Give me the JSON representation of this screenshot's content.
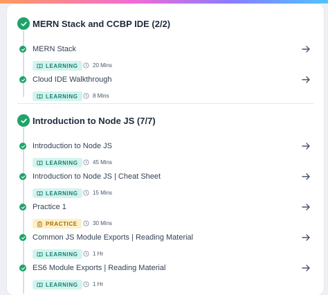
{
  "sections": [
    {
      "title": "MERN Stack and CCBP IDE (2/2)",
      "items": [
        {
          "title": "MERN Stack",
          "badge": "LEARNING",
          "duration": "20 Mins"
        },
        {
          "title": "Cloud IDE Walkthrough",
          "badge": "LEARNING",
          "duration": "8 Mins"
        }
      ]
    },
    {
      "title": "Introduction to Node JS (7/7)",
      "items": [
        {
          "title": "Introduction to Node JS",
          "badge": "LEARNING",
          "duration": "45 Mins"
        },
        {
          "title": "Introduction to Node JS | Cheat Sheet",
          "badge": "LEARNING",
          "duration": "15 Mins"
        },
        {
          "title": "Practice 1",
          "badge": "PRACTICE",
          "duration": "30 Mins"
        },
        {
          "title": "Common JS Module Exports | Reading Material",
          "badge": "LEARNING",
          "duration": "1 Hr"
        },
        {
          "title": "ES6 Module Exports | Reading Material",
          "badge": "LEARNING",
          "duration": "1 Hr"
        }
      ]
    }
  ],
  "icons": {
    "section_status": "check-circle-icon",
    "item_status": "check-dot-icon",
    "open": "arrow-right-icon",
    "learning": "book-icon",
    "practice": "clipboard-icon",
    "duration": "clock-icon"
  },
  "colors": {
    "complete": "#1fa36a",
    "learning_bg": "#d3f4ee",
    "learning_text": "#15806f",
    "practice_bg": "#fdf0c8",
    "practice_text": "#a46b05"
  }
}
